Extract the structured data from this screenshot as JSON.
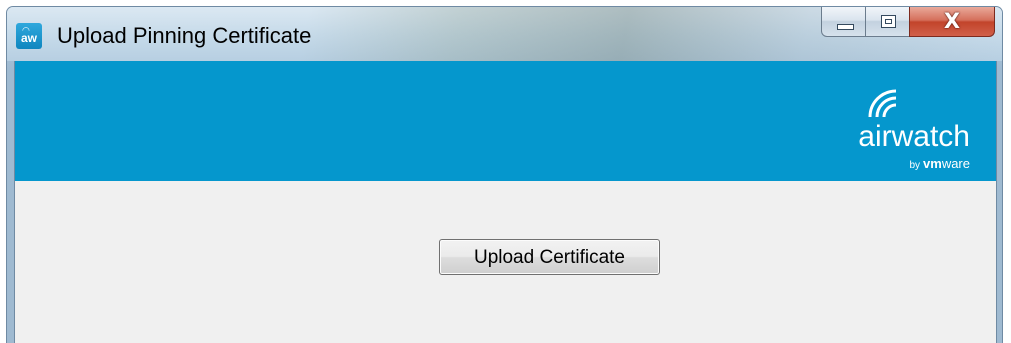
{
  "window": {
    "title": "Upload Pinning Certificate",
    "app_icon_text": "aw",
    "controls": {
      "minimize": "minimize",
      "maximize": "maximize",
      "close_glyph": "X"
    }
  },
  "banner": {
    "color": "#0597cd",
    "logo": {
      "word": "airwatch",
      "by": "by",
      "vendor": "vmware"
    }
  },
  "main": {
    "upload_button_label": "Upload Certificate"
  },
  "icons": [
    "airwatch-app-icon",
    "minimize-icon",
    "maximize-icon",
    "close-icon",
    "airwatch-wifi-logo-icon"
  ]
}
